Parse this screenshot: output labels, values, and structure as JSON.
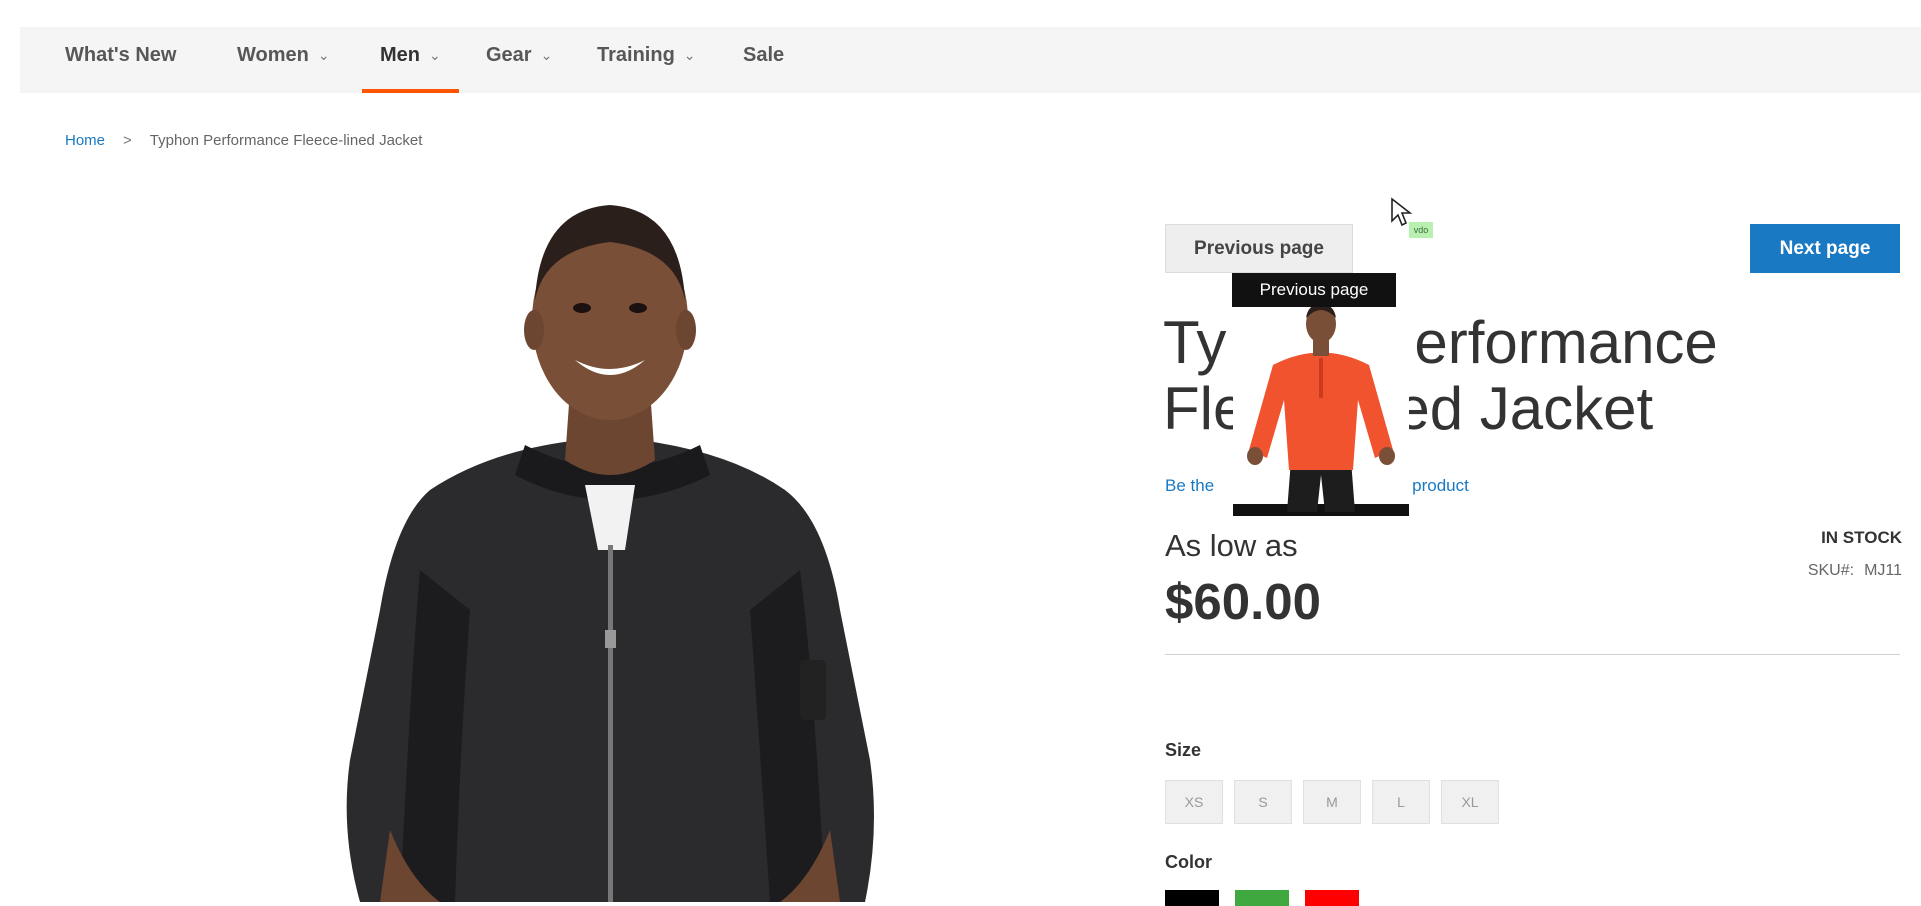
{
  "nav": {
    "items": [
      {
        "label": "What's New",
        "has_dropdown": false,
        "active": false
      },
      {
        "label": "Women",
        "has_dropdown": true,
        "active": false
      },
      {
        "label": "Men",
        "has_dropdown": true,
        "active": true
      },
      {
        "label": "Gear",
        "has_dropdown": true,
        "active": false
      },
      {
        "label": "Training",
        "has_dropdown": true,
        "active": false
      },
      {
        "label": "Sale",
        "has_dropdown": false,
        "active": false
      }
    ],
    "accent_color": "#ff5501"
  },
  "breadcrumb": {
    "home": "Home",
    "separator": ">",
    "current": "Typhon Performance Fleece-lined Jacket"
  },
  "pager": {
    "prev_label": "Previous page",
    "next_label": "Next page",
    "tooltip": "Previous page",
    "next_color": "#1979c3"
  },
  "cursor": {
    "tag": "vdo"
  },
  "product": {
    "title_line1": "Typhon Performance",
    "title_line2": "Fleece-lined Jacket",
    "title_visible_line1_left": "Ty",
    "title_visible_line1_right": "erformance",
    "title_visible_line2_left": "Fle",
    "title_visible_line2_right": "ed Jacket",
    "review_left": "Be the",
    "review_right": "product",
    "price_prefix": "As low as",
    "price": "$60.00",
    "stock": "IN STOCK",
    "sku_label": "SKU#:",
    "sku": "MJ11"
  },
  "options": {
    "size_label": "Size",
    "sizes": [
      "XS",
      "S",
      "M",
      "L",
      "XL"
    ],
    "color_label": "Color",
    "colors": [
      "#000000",
      "#3fa83f",
      "#ff0000"
    ]
  }
}
